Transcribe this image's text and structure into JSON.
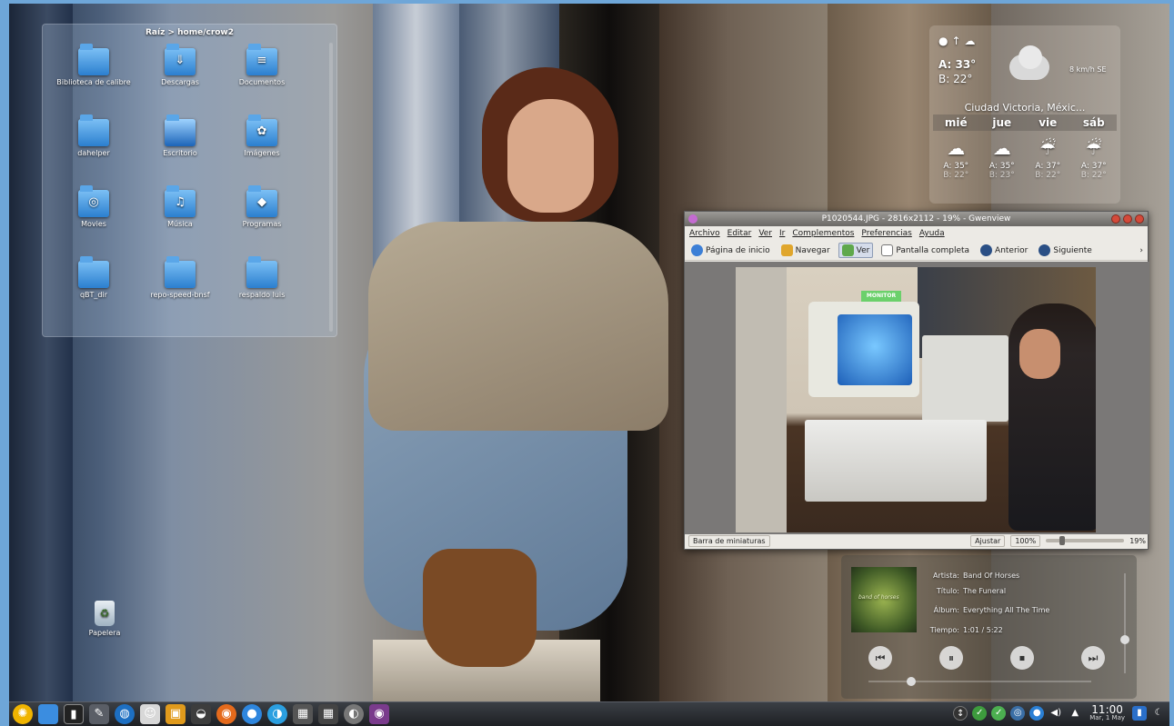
{
  "folder_view": {
    "title": "Raíz > home/crow2",
    "items": [
      {
        "label": "Biblioteca de calibre",
        "icon": "folder-icon"
      },
      {
        "label": "Descargas",
        "icon": "downloads-folder-icon"
      },
      {
        "label": "Documentos",
        "icon": "documents-folder-icon"
      },
      {
        "label": "dahelper",
        "icon": "folder-icon"
      },
      {
        "label": "Escritorio",
        "icon": "desktop-folder-icon"
      },
      {
        "label": "Imágenes",
        "icon": "pictures-folder-icon"
      },
      {
        "label": "Movies",
        "icon": "movies-folder-icon"
      },
      {
        "label": "Música",
        "icon": "music-folder-icon"
      },
      {
        "label": "Programas",
        "icon": "programs-folder-icon"
      },
      {
        "label": "qBT_dir",
        "icon": "folder-icon"
      },
      {
        "label": "repo-speed-bnsf",
        "icon": "folder-icon"
      },
      {
        "label": "respaldo luis",
        "icon": "folder-icon"
      }
    ]
  },
  "trash": {
    "label": "Papelera"
  },
  "weather": {
    "high": "A: 33°",
    "low": "B: 22°",
    "wind": "8 km/h SE",
    "city": "Ciudad Victoria, Méxic...",
    "days": [
      "mié",
      "jue",
      "vie",
      "sáb"
    ],
    "forecast": [
      {
        "hi": "A: 35°",
        "lo": "B: 22°",
        "icon": "cloudy-icon"
      },
      {
        "hi": "A: 35°",
        "lo": "B: 23°",
        "icon": "cloudy-icon"
      },
      {
        "hi": "A: 37°",
        "lo": "B: 22°",
        "icon": "rain-icon"
      },
      {
        "hi": "A: 37°",
        "lo": "B: 22°",
        "icon": "rain-icon"
      }
    ]
  },
  "gwenview": {
    "title": "P1020544.JPG - 2816x2112 - 19% - Gwenview",
    "menus": [
      "Archivo",
      "Editar",
      "Ver",
      "Ir",
      "Complementos",
      "Preferencias",
      "Ayuda"
    ],
    "toolbar": {
      "home": "Página de inicio",
      "browse": "Navegar",
      "view": "Ver",
      "fullscreen": "Pantalla completa",
      "previous": "Anterior",
      "next": "Siguiente"
    },
    "photo_label": "MONITOR",
    "statusbar": {
      "thumbnails": "Barra de miniaturas",
      "fit": "Ajustar",
      "zoom100": "100%",
      "zoom_value": "19%",
      "zoom_fraction": 0.19
    }
  },
  "player": {
    "artist_key": "Artista:",
    "artist": "Band Of Horses",
    "title_key": "Título:",
    "title": "The Funeral",
    "album_key": "Álbum:",
    "album": "Everything All The Time",
    "time_key": "Tiempo:",
    "time": "1:01 / 5:22",
    "cover_text": "band of horses"
  },
  "taskbar": {
    "clock_time": "11:00",
    "clock_date": "Mar, 1 May"
  }
}
